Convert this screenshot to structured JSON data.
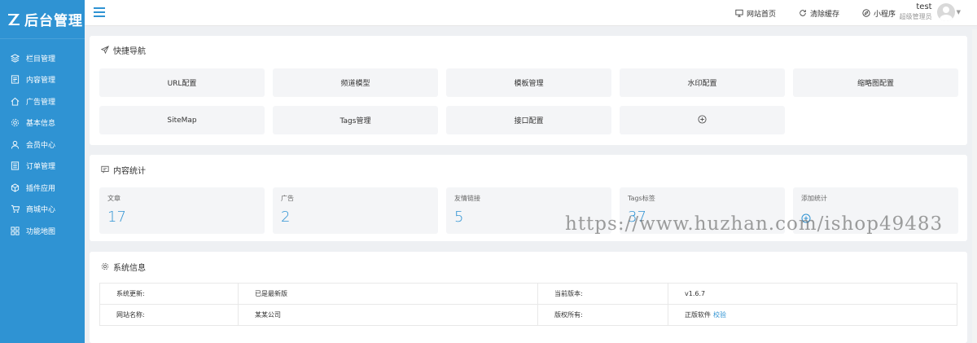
{
  "brand": {
    "logo_text": "后台管理",
    "accent": "#2f93d3"
  },
  "sidebar": {
    "items": [
      {
        "label": "栏目管理",
        "icon": "layers-icon"
      },
      {
        "label": "内容管理",
        "icon": "document-icon"
      },
      {
        "label": "广告管理",
        "icon": "home-icon"
      },
      {
        "label": "基本信息",
        "icon": "gear-icon"
      },
      {
        "label": "会员中心",
        "icon": "user-icon"
      },
      {
        "label": "订单管理",
        "icon": "list-icon"
      },
      {
        "label": "插件应用",
        "icon": "cube-icon"
      },
      {
        "label": "商城中心",
        "icon": "cart-icon"
      },
      {
        "label": "功能地图",
        "icon": "grid-icon"
      }
    ]
  },
  "topbar": {
    "actions": [
      {
        "label": "网站首页",
        "icon": "monitor-icon"
      },
      {
        "label": "清除缓存",
        "icon": "refresh-icon"
      },
      {
        "label": "小程序",
        "icon": "compass-icon"
      }
    ],
    "user": {
      "name": "test",
      "role": "超级管理员"
    }
  },
  "quick_nav": {
    "title": "快捷导航",
    "buttons": [
      "URL配置",
      "频道模型",
      "模板管理",
      "水印配置",
      "缩略图配置",
      "SiteMap",
      "Tags管理",
      "接口配置"
    ],
    "add_icon": "plus-circle-icon"
  },
  "stats": {
    "title": "内容统计",
    "items": [
      {
        "label": "文章",
        "value": "17"
      },
      {
        "label": "广告",
        "value": "2"
      },
      {
        "label": "友情链接",
        "value": "5"
      },
      {
        "label": "Tags标签",
        "value": "37"
      }
    ],
    "add_label": "添加统计"
  },
  "system": {
    "title": "系统信息",
    "rows": [
      {
        "k1": "系统更新:",
        "v1": "已是最新版",
        "k2": "当前版本:",
        "v2": "v1.6.7",
        "v2_link": ""
      },
      {
        "k1": "网站名称:",
        "v1": "某某公司",
        "k2": "版权所有:",
        "v2": "正版软件",
        "v2_link": "校验"
      }
    ]
  },
  "watermark": "https://www.huzhan.com/ishop49483"
}
